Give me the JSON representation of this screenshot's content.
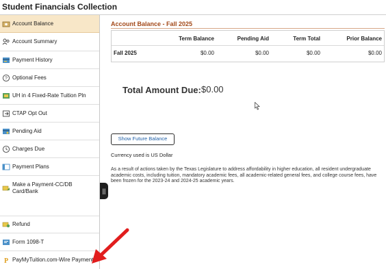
{
  "app": {
    "title": "Student Financials Collection"
  },
  "sidebar": {
    "items": [
      {
        "label": "Account Balance",
        "icon": "account-balance-icon",
        "active": true
      },
      {
        "label": "Account Summary",
        "icon": "people-icon"
      },
      {
        "label": "Payment History",
        "icon": "payment-history-icon"
      },
      {
        "label": "Optional Fees",
        "icon": "help-circle-icon"
      },
      {
        "label": "UH in 4 Fixed-Rate Tuition Pln",
        "icon": "tuition-plan-icon"
      },
      {
        "label": "CTAP Opt Out",
        "icon": "opt-out-icon"
      },
      {
        "label": "Pending Aid",
        "icon": "pending-aid-icon"
      },
      {
        "label": "Charges Due",
        "icon": "clock-icon"
      },
      {
        "label": "Payment Plans",
        "icon": "payment-plans-icon"
      },
      {
        "label": "Make a Payment-CC/DB Card/Bank",
        "icon": "make-payment-icon"
      },
      {
        "label": "Refund",
        "icon": "refund-icon"
      },
      {
        "label": "Form 1098-T",
        "icon": "form-icon"
      },
      {
        "label": "PayMyTuition.com-Wire Payments",
        "icon": "paymytuition-icon"
      }
    ],
    "collapse_handle": "||"
  },
  "main": {
    "section_title": "Account Balance - Fall 2025",
    "table": {
      "headers": [
        "Term Balance",
        "Pending Aid",
        "Term Total",
        "Prior Balance"
      ],
      "rows": [
        {
          "term": "Fall 2025",
          "values": [
            "$0.00",
            "$0.00",
            "$0.00",
            "$0.00"
          ]
        }
      ]
    },
    "total_label": "Total Amount Due:",
    "total_value": "$0.00",
    "future_button": "Show Future Balance",
    "currency_note": "Currency used is US Dollar",
    "legislature_note": "As a result of actions taken by the Texas Legislature to address affordability in higher education, all resident undergraduate academic costs, including tuition, mandatory academic fees, all academic-related general fees, and college course fees, have been frozen for the 2023-24 and 2024-25 academic years."
  },
  "colors": {
    "active_bg": "#f8e7c8",
    "section_title": "#a34a1a",
    "link_blue": "#1f5fa6",
    "arrow_red": "#e11d1d"
  }
}
